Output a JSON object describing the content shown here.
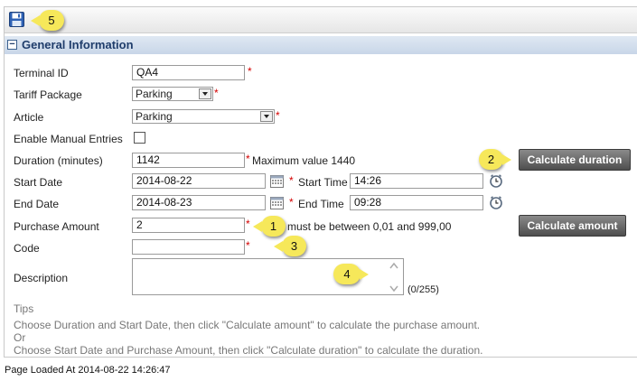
{
  "toolbar": {
    "save_icon": "floppy-disk-icon"
  },
  "callouts": {
    "c1": "1",
    "c2": "2",
    "c3": "3",
    "c4": "4",
    "c5": "5"
  },
  "section": {
    "title": "General Information",
    "collapse_glyph": "−"
  },
  "form": {
    "terminal_id": {
      "label": "Terminal ID",
      "value": "QA4"
    },
    "tariff_package": {
      "label": "Tariff Package",
      "value": "Parking"
    },
    "article": {
      "label": "Article",
      "value": "Parking"
    },
    "enable_manual": {
      "label": "Enable Manual Entries",
      "checked": false
    },
    "duration": {
      "label": "Duration (minutes)",
      "value": "1142",
      "hint": "Maximum value 1440"
    },
    "start_date": {
      "label": "Start Date",
      "value": "2014-08-22"
    },
    "start_time": {
      "label": "Start Time",
      "value": "14:26"
    },
    "end_date": {
      "label": "End Date",
      "value": "2014-08-23"
    },
    "end_time": {
      "label": "End Time",
      "value": "09:28"
    },
    "purchase_amount": {
      "label": "Purchase Amount",
      "value": "2",
      "hint_tail": "must be between 0,01 and 999,00"
    },
    "code": {
      "label": "Code",
      "value": ""
    },
    "description": {
      "label": "Description",
      "counter": "(0/255)"
    },
    "required_mark": "*"
  },
  "buttons": {
    "calc_duration": "Calculate duration",
    "calc_amount": "Calculate amount"
  },
  "tips": {
    "heading": "Tips",
    "line1": "Choose Duration and Start Date, then click \"Calculate amount\" to calculate the purchase amount.",
    "line2": "Or",
    "line3": "Choose Start Date and Purchase Amount, then click \"Calculate duration\" to calculate the duration."
  },
  "footer": {
    "text": "Page Loaded At 2014-08-22 14:26:47"
  },
  "colors": {
    "header_text": "#1f3d6b",
    "required": "#d40000",
    "callout": "#f6e85a",
    "button": "#5a5a5a"
  }
}
